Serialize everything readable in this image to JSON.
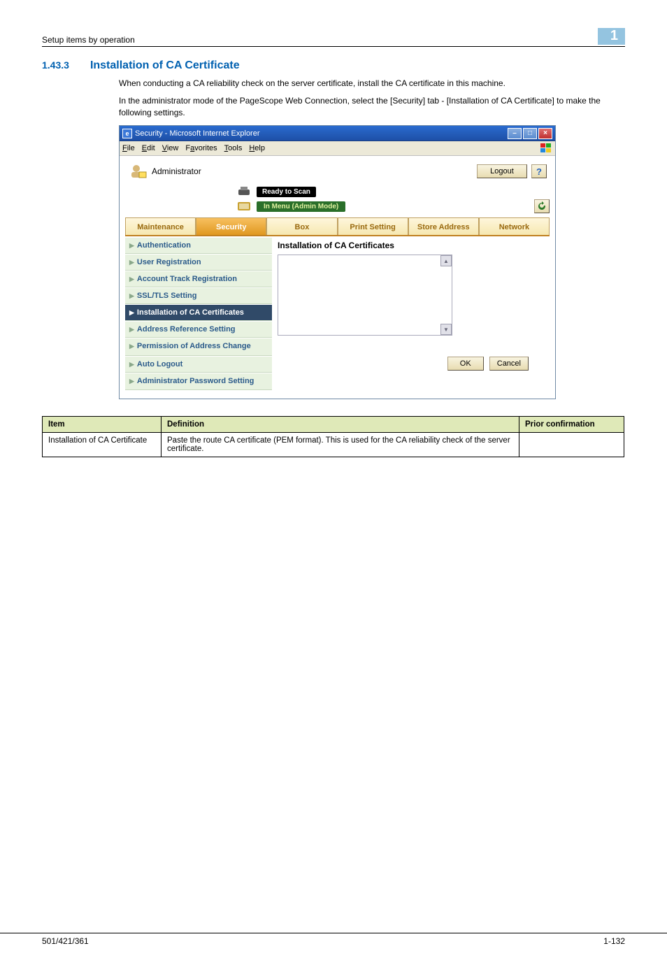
{
  "header": {
    "breadcrumb": "Setup items by operation",
    "chapter_index": "1"
  },
  "section": {
    "number": "1.43.3",
    "title": "Installation of CA Certificate"
  },
  "body_paragraphs": {
    "p1": "When conducting a CA reliability check on the server certificate, install the CA certificate in this machine.",
    "p2": "In the administrator mode of the PageScope Web Connection, select the [Security] tab - [Installation of CA Certificate] to make the following settings."
  },
  "ie_window": {
    "title": "Security - Microsoft Internet Explorer",
    "menus": {
      "file": "File",
      "edit": "Edit",
      "view": "View",
      "favorites": "Favorites",
      "tools": "Tools",
      "help": "Help"
    },
    "admin_label": "Administrator",
    "logout": "Logout",
    "status_ready": "Ready to Scan",
    "status_menu": "In Menu (Admin Mode)",
    "tabs": {
      "maintenance": "Maintenance",
      "security": "Security",
      "box": "Box",
      "print_setting": "Print Setting",
      "store_address": "Store Address",
      "network": "Network"
    },
    "sidenav": {
      "authentication": "Authentication",
      "user_registration": "User Registration",
      "account_track": "Account Track Registration",
      "ssl_tls": "SSL/TLS Setting",
      "install_ca": "Installation of CA Certificates",
      "addr_ref": "Address Reference Setting",
      "perm_addr": "Permission of Address Change",
      "auto_logout": "Auto Logout",
      "admin_pwd": "Administrator Password Setting"
    },
    "content_heading": "Installation of CA Certificates",
    "buttons": {
      "ok": "OK",
      "cancel": "Cancel"
    }
  },
  "def_table": {
    "head": {
      "item": "Item",
      "definition": "Definition",
      "prior": "Prior confirmation"
    },
    "row1": {
      "item": "Installation of CA Certificate",
      "definition": "Paste the route CA certificate (PEM format). This is used for the CA reliability check of the server certificate.",
      "prior": ""
    }
  },
  "footer": {
    "left": "501/421/361",
    "right": "1-132"
  }
}
